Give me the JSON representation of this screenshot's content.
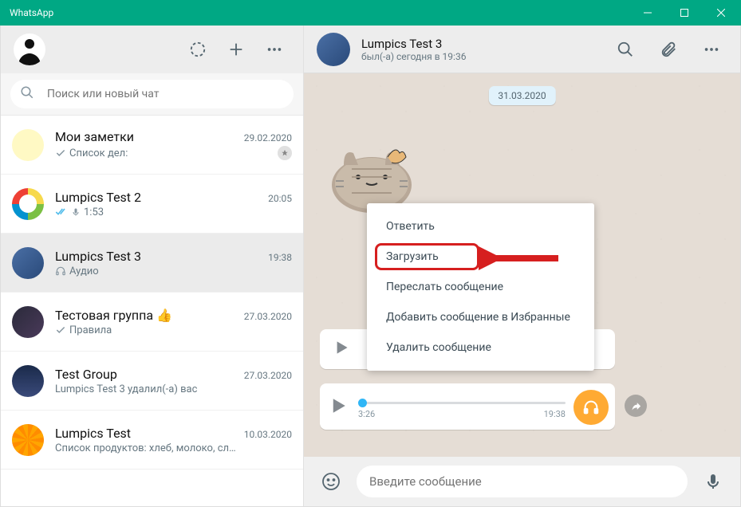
{
  "window": {
    "title": "WhatsApp"
  },
  "search": {
    "placeholder": "Поиск или новый чат"
  },
  "chats": [
    {
      "name": "Мои заметки",
      "sub": "Список дел:",
      "time": "29.02.2020",
      "kind": "note",
      "pinned": true,
      "icon": "check"
    },
    {
      "name": "Lumpics Test 2",
      "sub": "1:53",
      "time": "20:05",
      "kind": "wheel",
      "icon": "mic-dbl"
    },
    {
      "name": "Lumpics Test 3",
      "sub": "Аудио",
      "time": "19:38",
      "kind": "blue",
      "icon": "headphones",
      "active": true
    },
    {
      "name": "Тестовая группа 👍",
      "sub": "Правила",
      "time": "27.03.2020",
      "kind": "tech",
      "icon": "check"
    },
    {
      "name": "Test Group",
      "sub": "Lumpics Test 3 удалил(-а) вас",
      "time": "27.03.2020",
      "kind": "dark"
    },
    {
      "name": "Lumpics Test",
      "sub": "Список продуктов: хлеб, молоко, сл…",
      "time": "10.03.2020",
      "kind": "orange"
    }
  ],
  "header": {
    "name": "Lumpics Test 3",
    "status": "был(-а) сегодня в 19:36"
  },
  "date_badge": "31.03.2020",
  "audio": {
    "elapsed": "3:26",
    "time": "19:38"
  },
  "menu": {
    "reply": "Ответить",
    "download": "Загрузить",
    "forward": "Переслать сообщение",
    "star": "Добавить сообщение в Избранные",
    "delete": "Удалить сообщение"
  },
  "composer": {
    "placeholder": "Введите сообщение"
  }
}
